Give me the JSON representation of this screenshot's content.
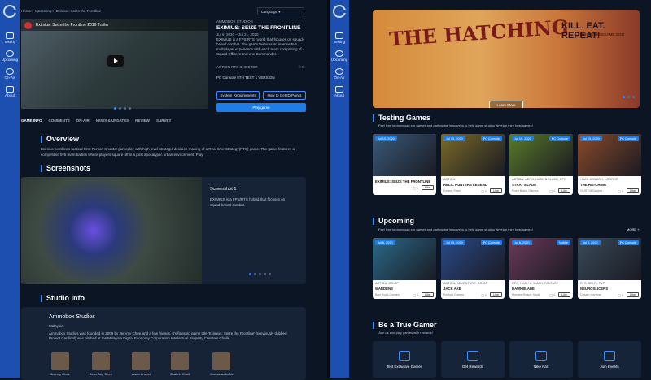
{
  "nav": [
    "Testing",
    "Upcoming",
    "On-Air",
    "About"
  ],
  "left": {
    "breadcrumb": "Home  >  Upcoming  >  Eximius: Seize the Frontline",
    "language": "Language",
    "video_title": "Eximius: Seize the Frontline 2019 Trailer",
    "studio_small": "AMMOBOX STUDIOS",
    "game_title": "EXIMIUS: SEIZE THE FRONTLINE",
    "dates": "Jul 6, 2020 – Jul 21, 2020",
    "blurb": "EXIMIUS is a FPS/RTS hybrid that focuses on squad-based combat. The game features an intense 5v5 multiplayer experience with each team comprising of 4 Squad Officers and one Commander.",
    "tags": "ACTION   RTS   SHOOTER",
    "likes": "0",
    "platform": "PC Console   5TH TEST   1 VERSION",
    "btn_sys": "System Requirements",
    "btn_how": "How to Get ID/Points",
    "btn_play": "Play game",
    "tabs": [
      "GAME INFO",
      "COMMENTS",
      "ON-AIR",
      "NEWS & UPDATES",
      "REVIEW",
      "SURVEY"
    ],
    "overview_h": "Overview",
    "overview": "Eximius combines tactical First Person Shooter gameplay with high level strategic decision-making of a Real-time Strategy(RTS) game. The game features a competitive 5v5 team battles where players square off in a post apocalyptic urban environment. Play",
    "shots_h": "Screenshots",
    "shot_title": "Screenshot 1",
    "shot_desc": "EXIMIUS is a FPS/RTS hybrid that focuses on squad-based combat.",
    "studio_h": "Studio Info",
    "studio_name": "Ammobox Studios",
    "studio_country": "Malaysia",
    "studio_text": "Ammobox Studios was founded in 2009 by Jeremy Chee and a few friends. It's flagship game title 'Eximius: Seize the Frontline' (previously dubbed Project Cardinal) was pitched at the Malaysia Digital Economy Corporation Intellectual Property Creators Challe",
    "team": [
      "Jeremy Chee",
      "Dean Ang Shen",
      "Awab Anwari",
      "Shahrin Khalil",
      "Vivekananda Ne"
    ]
  },
  "right": {
    "hero_title": "THE HATCHING",
    "hero_tag": "KILL. EAT. REPEAT!",
    "hero_url": "THEHATCHINGGAME.COM",
    "learn_more": "Learn More",
    "testing_h": "Testing Games",
    "testing_sub": "Feel free to download our games and participate in surveys to help game studios develop their best games!",
    "testing": [
      {
        "date": "Jul 15, 2020",
        "badge": "",
        "genre": "",
        "name": "EXIMIUS: SEIZE THE FRONTLINE",
        "dev": "",
        "likes": "0",
        "color": "#3a5a7a"
      },
      {
        "date": "Jul 15, 2020",
        "badge": "PC Console",
        "genre": "ACTION",
        "name": "RELIC HUNTERS LEGEND",
        "dev": "Rogue Snail",
        "likes": "0",
        "color": "#7a6a2a"
      },
      {
        "date": "Jul 15, 2020",
        "badge": "PC Console",
        "genre": "ACTION, ARPG, HACK & SLASH, RPG",
        "name": "STRAY BLADE",
        "dev": "Point Blank Games",
        "likes": "0",
        "color": "#5a7a2a"
      },
      {
        "date": "Jul 15, 2020",
        "badge": "PC Console",
        "genre": "HACK & SLASH, HORROR",
        "name": "THE HATCHING",
        "dev": "GUSTIA Games",
        "likes": "0",
        "color": "#8a4a2a"
      }
    ],
    "upcoming_h": "Upcoming",
    "more": "MORE +",
    "upcoming_sub": "Feel free to download our games and participate in surveys to help game studios develop their best games!",
    "upcoming": [
      {
        "date": "Jul 6, 2020",
        "badge": "",
        "genre": "ACTION, CO-OP",
        "name": "WARDENS",
        "dev": "Bad Rock Games",
        "likes": "0",
        "color": "#2a6a8a"
      },
      {
        "date": "Jul 15, 2020",
        "badge": "PC Console",
        "genre": "ACTION, ADVENTURE, CO-OP",
        "name": "JACK AXE",
        "dev": "Keybot Games",
        "likes": "0",
        "color": "#2a4a8a"
      },
      {
        "date": "Jul 6, 2020",
        "badge": "Mobile",
        "genre": "RPG, HACK & SLASH, FANTASY",
        "name": "DAWNBLADE",
        "dev": "MonsterScape Studi",
        "likes": "0",
        "color": "#6a3a5a"
      },
      {
        "date": "Jul 8, 2020",
        "badge": "PC Console",
        "genre": "RTS, SCI-FI, PVP",
        "name": "NEUROSLICERS",
        "dev": "Dream Harvest",
        "likes": "0",
        "color": "#3a4a5a"
      }
    ],
    "gamer_h": "Be a True Gamer",
    "gamer_sub": "Join us and play games with rewards!",
    "perks": [
      "Test Exclusive Games",
      "Get Rewards",
      "Take Part",
      "Join Events"
    ]
  }
}
